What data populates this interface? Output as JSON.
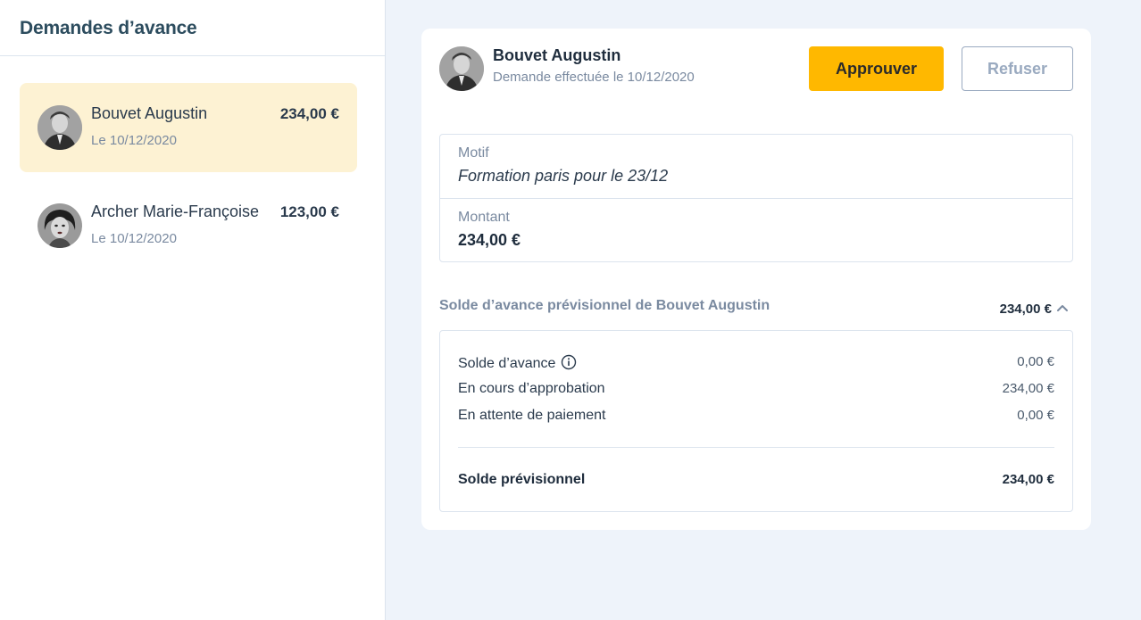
{
  "sidebar": {
    "title": "Demandes d’avance",
    "requests": [
      {
        "name": "Bouvet Augustin",
        "date": "Le 10/12/2020",
        "amount": "234,00 €",
        "selected": true
      },
      {
        "name": "Archer Marie-Françoise",
        "date": "Le 10/12/2020",
        "amount": "123,00 €",
        "selected": false
      }
    ]
  },
  "detail": {
    "name": "Bouvet Augustin",
    "subtitle": "Demande effectuée le 10/12/2020",
    "approve_label": "Approuver",
    "refuse_label": "Refuser",
    "motif_label": "Motif",
    "motif_value": "Formation paris pour le 23/12",
    "montant_label": "Montant",
    "montant_value": "234,00 €",
    "solde": {
      "title": "Solde d’avance prévisionnel de Bouvet Augustin",
      "total": "234,00 €",
      "rows": [
        {
          "label": "Solde d’avance",
          "value": "0,00 €"
        },
        {
          "label": "En cours d’approbation",
          "value": "234,00 €"
        },
        {
          "label": "En attente de paiement",
          "value": "0,00 €"
        }
      ],
      "final_label": "Solde prévisionnel",
      "final_value": "234,00 €"
    }
  },
  "colors": {
    "accent": "#ffb800",
    "selected_bg": "#fdf2d3",
    "page_bg": "#eef3fa"
  },
  "icons": {
    "info": "info-circle-icon",
    "chevron": "chevron-up-icon",
    "avatar": "avatar"
  }
}
